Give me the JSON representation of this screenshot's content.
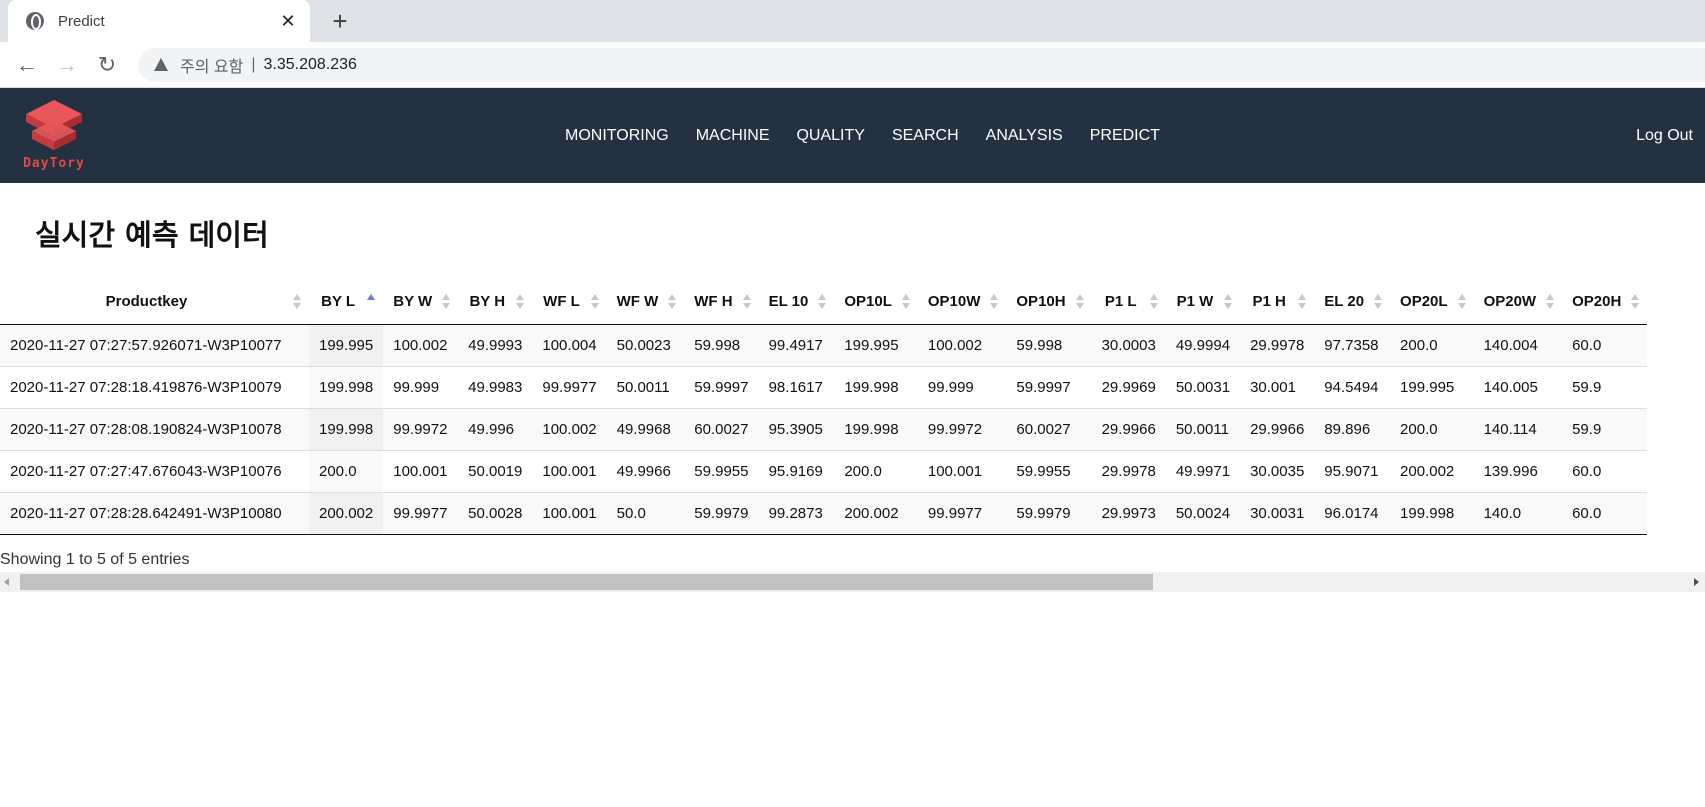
{
  "browser": {
    "tab_title": "Predict",
    "tab_close": "✕",
    "new_tab": "+",
    "back": "←",
    "forward": "→",
    "reload": "↻",
    "security_label": "주의 요함",
    "separator": "|",
    "url": "3.35.208.236"
  },
  "header": {
    "logo_text": "DayTory",
    "nav": [
      "MONITORING",
      "MACHINE",
      "QUALITY",
      "SEARCH",
      "ANALYSIS",
      "PREDICT"
    ],
    "logout": "Log Out"
  },
  "page": {
    "title": "실시간 예측 데이터"
  },
  "table": {
    "columns": [
      "Productkey",
      "BY L",
      "BY W",
      "BY H",
      "WF L",
      "WF W",
      "WF H",
      "EL 10",
      "OP10L",
      "OP10W",
      "OP10H",
      "P1 L",
      "P1 W",
      "P1 H",
      "EL 20",
      "OP20L",
      "OP20W",
      "OP20H"
    ],
    "sorted_column": "BY L",
    "rows": [
      [
        "2020-11-27 07:27:57.926071-W3P10077",
        "199.995",
        "100.002",
        "49.9993",
        "100.004",
        "50.0023",
        "59.998",
        "99.4917",
        "199.995",
        "100.002",
        "59.998",
        "30.0003",
        "49.9994",
        "29.9978",
        "97.7358",
        "200.0",
        "140.004",
        "60.0"
      ],
      [
        "2020-11-27 07:28:18.419876-W3P10079",
        "199.998",
        "99.999",
        "49.9983",
        "99.9977",
        "50.0011",
        "59.9997",
        "98.1617",
        "199.998",
        "99.999",
        "59.9997",
        "29.9969",
        "50.0031",
        "30.001",
        "94.5494",
        "199.995",
        "140.005",
        "59.9"
      ],
      [
        "2020-11-27 07:28:08.190824-W3P10078",
        "199.998",
        "99.9972",
        "49.996",
        "100.002",
        "49.9968",
        "60.0027",
        "95.3905",
        "199.998",
        "99.9972",
        "60.0027",
        "29.9966",
        "50.0011",
        "29.9966",
        "89.896",
        "200.0",
        "140.114",
        "59.9"
      ],
      [
        "2020-11-27 07:27:47.676043-W3P10076",
        "200.0",
        "100.001",
        "50.0019",
        "100.001",
        "49.9966",
        "59.9955",
        "95.9169",
        "200.0",
        "100.001",
        "59.9955",
        "29.9978",
        "49.9971",
        "30.0035",
        "95.9071",
        "200.002",
        "139.996",
        "60.0"
      ],
      [
        "2020-11-27 07:28:28.642491-W3P10080",
        "200.002",
        "99.9977",
        "50.0028",
        "100.001",
        "50.0",
        "59.9979",
        "99.2873",
        "200.002",
        "99.9977",
        "59.9979",
        "29.9973",
        "50.0024",
        "30.0031",
        "96.0174",
        "199.998",
        "140.0",
        "60.0"
      ]
    ],
    "info": "Showing 1 to 5 of 5 entries"
  },
  "colors": {
    "header_bg": "#243140",
    "logo_red": "#e04a4a",
    "sort_active": "#6b7bd6"
  }
}
